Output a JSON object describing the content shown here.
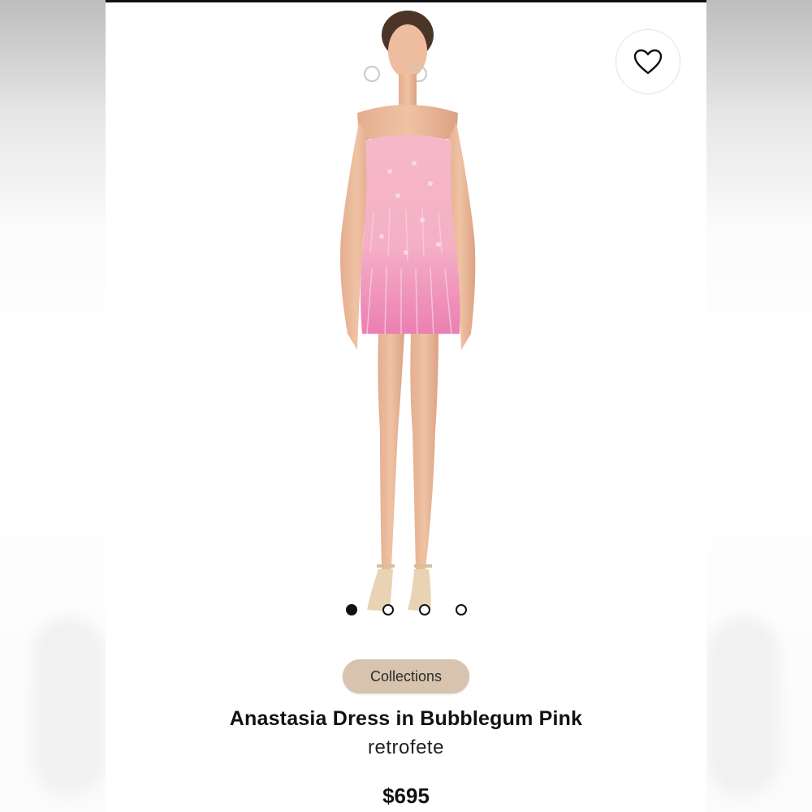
{
  "product": {
    "badge_label": "Collections",
    "title": "Anastasia Dress in Bubblegum Pink",
    "brand": "retrofete",
    "price": "$695",
    "image_alt": "model wearing strapless pink feather sequin mini dress"
  },
  "gallery": {
    "dots": [
      {
        "active": true
      },
      {
        "active": false
      },
      {
        "active": false
      },
      {
        "active": false
      }
    ]
  },
  "icons": {
    "favorite": "heart-icon"
  },
  "colors": {
    "badge_bg": "#d7c3ae",
    "dress_pink": "#f2a7bf",
    "active_dot": "#111111"
  }
}
